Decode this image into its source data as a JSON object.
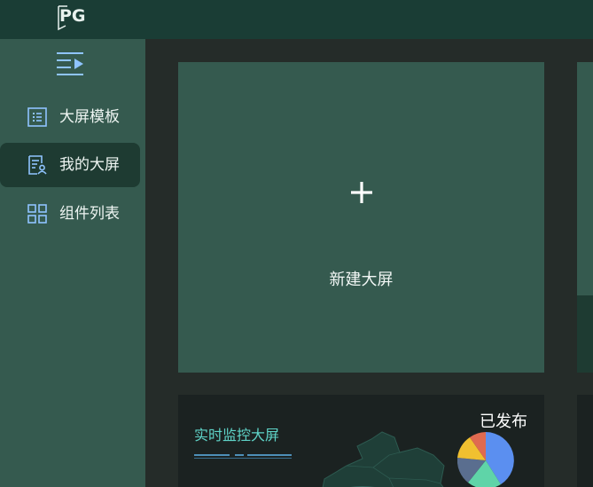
{
  "app": {
    "logo_text": "PG"
  },
  "sidebar": {
    "items": [
      {
        "label": "大屏模板",
        "icon": "template-list-icon",
        "active": false
      },
      {
        "label": "我的大屏",
        "icon": "user-document-icon",
        "active": true
      },
      {
        "label": "组件列表",
        "icon": "grid-icon",
        "active": false
      }
    ]
  },
  "main": {
    "new_card": {
      "label": "新建大屏",
      "icon": "plus-icon"
    },
    "cards": [
      {
        "title": "实时监控大屏",
        "status": "已发布"
      }
    ]
  },
  "colors": {
    "topbar": "#1a3d35",
    "sidebar": "#355a4f",
    "active_item": "#1e3b32",
    "main_bg": "#252c29",
    "accent_icon": "#8fc4ff",
    "card_title": "#5fd4c8"
  }
}
